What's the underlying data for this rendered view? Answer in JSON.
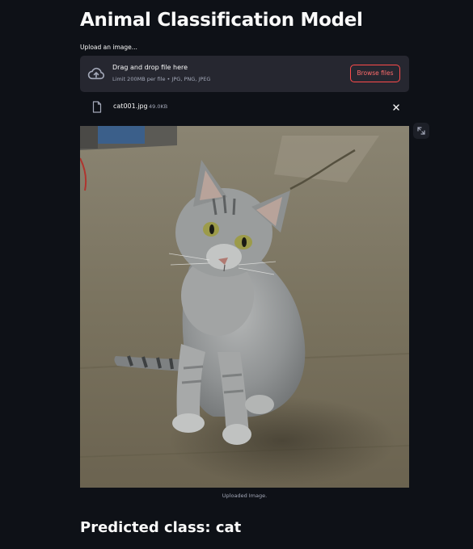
{
  "app": {
    "title": "Animal Classification Model"
  },
  "uploader": {
    "label": "Upload an image...",
    "drop_text": "Drag and drop file here",
    "limit_text": "Limit 200MB per file • JPG, PNG, JPEG",
    "browse_label": "Browse files",
    "accent_color": "#ff4b4b"
  },
  "file": {
    "name": "cat001.jpg",
    "size": "49.0KB",
    "icon": "file-icon",
    "remove_icon": "close-icon"
  },
  "image": {
    "caption": "Uploaded Image.",
    "subject": "cat",
    "expand_icon": "fullscreen-icon"
  },
  "result": {
    "prediction": "Predicted class: cat"
  },
  "colors": {
    "background": "#0e1117",
    "panel": "#262730",
    "text": "#fafafa",
    "muted": "#a3a8b8"
  }
}
